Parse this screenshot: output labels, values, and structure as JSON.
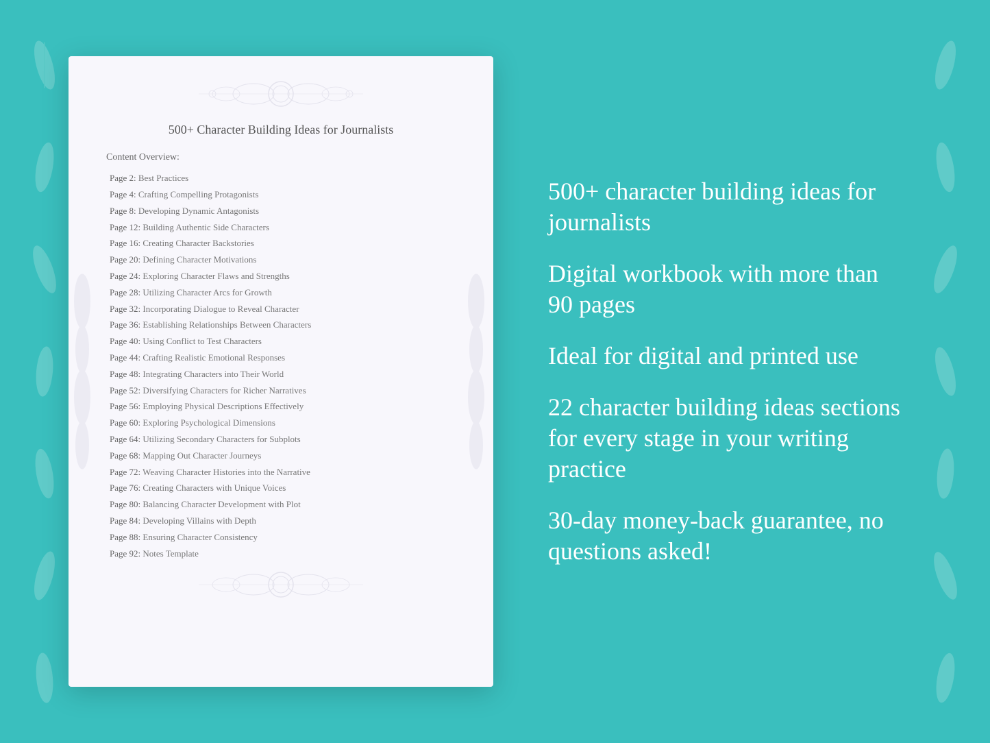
{
  "background": {
    "color": "#3abfbe"
  },
  "document": {
    "title": "500+ Character Building Ideas for\nJournalists",
    "content_overview_label": "Content Overview:",
    "toc": [
      {
        "page": "Page  2:",
        "title": "Best Practices"
      },
      {
        "page": "Page  4:",
        "title": "Crafting Compelling Protagonists"
      },
      {
        "page": "Page  8:",
        "title": "Developing Dynamic Antagonists"
      },
      {
        "page": "Page 12:",
        "title": "Building Authentic Side Characters"
      },
      {
        "page": "Page 16:",
        "title": "Creating Character Backstories"
      },
      {
        "page": "Page 20:",
        "title": "Defining Character Motivations"
      },
      {
        "page": "Page 24:",
        "title": "Exploring Character Flaws and Strengths"
      },
      {
        "page": "Page 28:",
        "title": "Utilizing Character Arcs for Growth"
      },
      {
        "page": "Page 32:",
        "title": "Incorporating Dialogue to Reveal Character"
      },
      {
        "page": "Page 36:",
        "title": "Establishing Relationships Between Characters"
      },
      {
        "page": "Page 40:",
        "title": "Using Conflict to Test Characters"
      },
      {
        "page": "Page 44:",
        "title": "Crafting Realistic Emotional Responses"
      },
      {
        "page": "Page 48:",
        "title": "Integrating Characters into Their World"
      },
      {
        "page": "Page 52:",
        "title": "Diversifying Characters for Richer Narratives"
      },
      {
        "page": "Page 56:",
        "title": "Employing Physical Descriptions Effectively"
      },
      {
        "page": "Page 60:",
        "title": "Exploring Psychological Dimensions"
      },
      {
        "page": "Page 64:",
        "title": "Utilizing Secondary Characters for Subplots"
      },
      {
        "page": "Page 68:",
        "title": "Mapping Out Character Journeys"
      },
      {
        "page": "Page 72:",
        "title": "Weaving Character Histories into the Narrative"
      },
      {
        "page": "Page 76:",
        "title": "Creating Characters with Unique Voices"
      },
      {
        "page": "Page 80:",
        "title": "Balancing Character Development with Plot"
      },
      {
        "page": "Page 84:",
        "title": "Developing Villains with Depth"
      },
      {
        "page": "Page 88:",
        "title": "Ensuring Character Consistency"
      },
      {
        "page": "Page 92:",
        "title": "Notes Template"
      }
    ]
  },
  "features": [
    "500+ character building ideas for journalists",
    "Digital workbook with more than 90 pages",
    "Ideal for digital and printed use",
    "22 character building ideas sections for every stage in your writing practice",
    "30-day money-back guarantee, no questions asked!"
  ]
}
